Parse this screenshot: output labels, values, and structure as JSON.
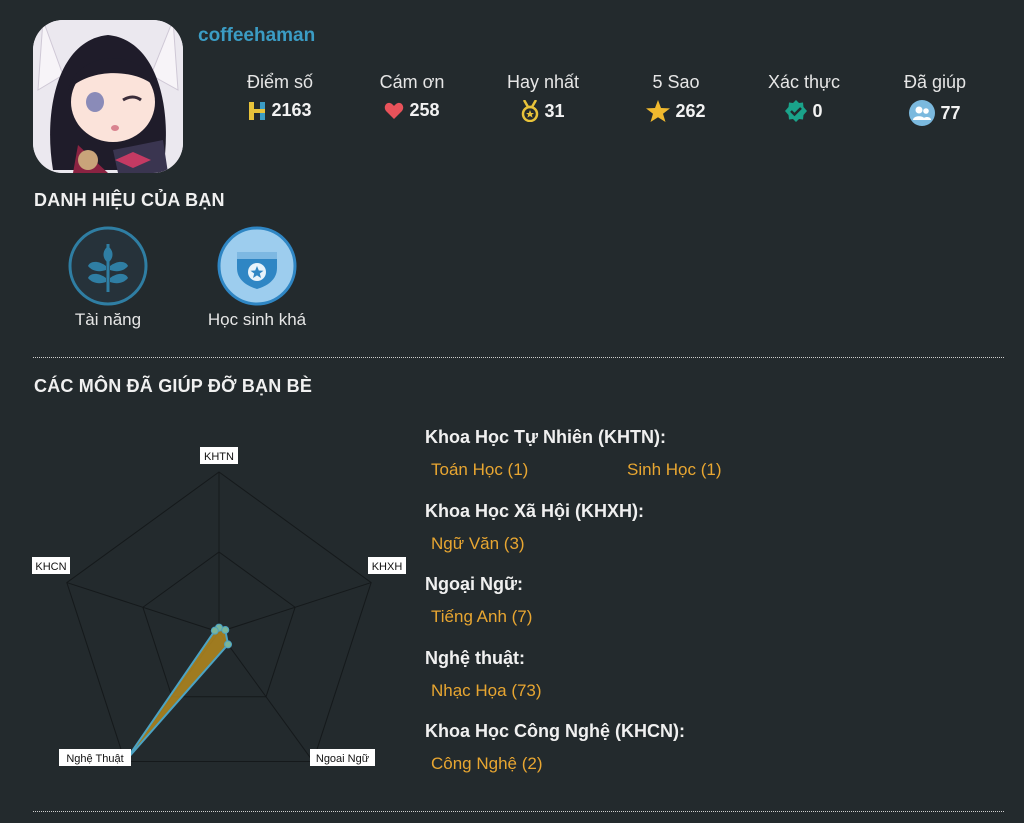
{
  "profile": {
    "username": "coffeehaman"
  },
  "stats": [
    {
      "label": "Điểm số",
      "value": "2163",
      "icon": "h-points-icon"
    },
    {
      "label": "Cám ơn",
      "value": "258",
      "icon": "heart-icon"
    },
    {
      "label": "Hay nhất",
      "value": "31",
      "icon": "medal-icon"
    },
    {
      "label": "5 Sao",
      "value": "262",
      "icon": "star-icon"
    },
    {
      "label": "Xác thực",
      "value": "0",
      "icon": "verified-check-icon"
    },
    {
      "label": "Đã giúp",
      "value": "77",
      "icon": "people-icon"
    }
  ],
  "titles_section": {
    "heading": "DANH HIỆU CỦA BẠN"
  },
  "badges": [
    {
      "name": "Tài năng",
      "icon": "leaf-icon"
    },
    {
      "name": "Học sinh khá",
      "icon": "shield-star-icon"
    }
  ],
  "subjects_section": {
    "heading": "CÁC MÔN ĐÃ GIÚP ĐỠ BẠN BÈ"
  },
  "radar_axes": [
    "KHTN",
    "KHXH",
    "Ngoai Ngữ",
    "Nghệ Thuật",
    "KHCN"
  ],
  "chart_data": {
    "type": "radar",
    "categories": [
      "KHTN",
      "KHXH",
      "Ngoai Ngữ",
      "Nghệ Thuật",
      "KHCN"
    ],
    "values": [
      2,
      3,
      7,
      73,
      2
    ],
    "max": 73
  },
  "subject_groups": [
    {
      "heading": "Khoa Học Tự Nhiên (KHTN):",
      "items": [
        "Toán Học (1)",
        "Sinh Học (1)"
      ]
    },
    {
      "heading": "Khoa Học Xã Hội (KHXH):",
      "items": [
        "Ngữ Văn (3)"
      ]
    },
    {
      "heading": "Ngoại Ngữ:",
      "items": [
        "Tiếng Anh (7)"
      ]
    },
    {
      "heading": "Nghệ thuật:",
      "items": [
        "Nhạc Họa (73)"
      ]
    },
    {
      "heading": "Khoa Học Công Nghệ (KHCN):",
      "items": [
        "Công Nghệ (2)"
      ]
    }
  ],
  "colors": {
    "accent_blue": "#3b9cc4",
    "link_orange": "#e8a631",
    "background": "#232a2d"
  }
}
